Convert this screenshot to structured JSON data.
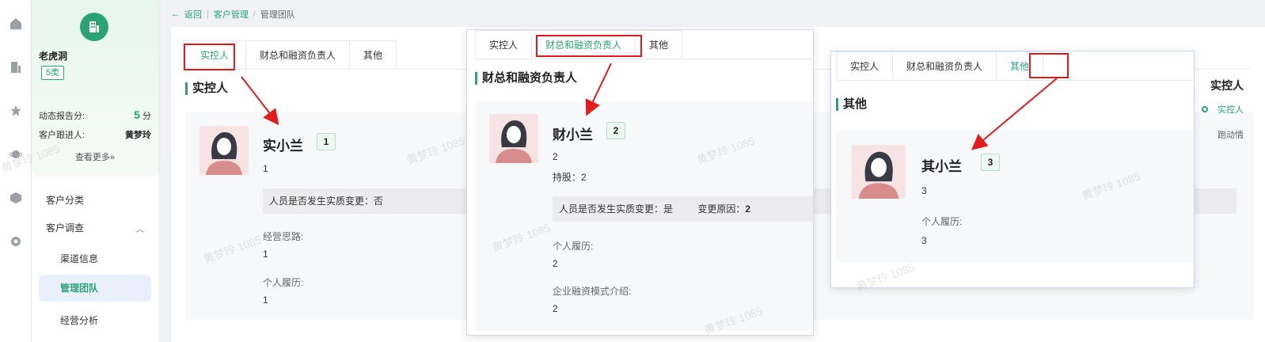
{
  "breadcrumb": {
    "back": "返回",
    "parent": "客户管理",
    "sep": "/",
    "current": "管理团队"
  },
  "rail": {
    "icons": [
      "home-icon",
      "building-icon",
      "star-icon",
      "planet-icon",
      "cube-icon",
      "settings-icon"
    ]
  },
  "sidebar": {
    "company_name": "老虎洞",
    "category_tag": "5类",
    "score_label": "动态报告分:",
    "score_value": "5",
    "score_unit": "分",
    "follower_label": "客户跟进人:",
    "follower_value": "黄梦玲",
    "view_more": "查看更多»",
    "menu": {
      "classification": "客户分类",
      "survey": "客户调查",
      "channel": "渠道信息",
      "team": "管理团队",
      "operation": "经营分析"
    }
  },
  "panel1": {
    "tabs": [
      "实控人",
      "财总和融资负责人",
      "其他"
    ],
    "active_tab": "实控人",
    "section_title": "实控人",
    "person": {
      "name": "实小兰",
      "badge": "1",
      "subtitle": "1",
      "change_question": "人员是否发生实质变更：否",
      "strategy_label": "经营思路:",
      "strategy_value": "1",
      "resume_label": "个人履历:",
      "resume_value": "1"
    }
  },
  "panel2": {
    "tabs": [
      "实控人",
      "财总和融资负责人",
      "其他"
    ],
    "active_tab": "财总和融资负责人",
    "section_title": "财总和融资负责人",
    "person": {
      "name": "财小兰",
      "badge": "2",
      "subtitle": "2",
      "shares": "持股：2",
      "change_question": "人员是否发生实质变更：是",
      "change_reason_label": "变更原因：",
      "change_reason_value": "2",
      "resume_label": "个人履历:",
      "resume_value": "2",
      "financing_label": "企业融资模式介绍:",
      "financing_value": "2"
    }
  },
  "panel3": {
    "tabs": [
      "实控人",
      "财总和融资负责人",
      "其他"
    ],
    "active_tab": "其他",
    "section_title": "其他",
    "person": {
      "name": "其小兰",
      "badge": "3",
      "subtitle": "3",
      "resume_label": "个人履历:",
      "resume_value": "3"
    }
  },
  "right_partial": {
    "title": "实控人",
    "item1": "实控人",
    "item2": "跑动情"
  },
  "watermark": "黄梦玲 1085",
  "colors": {
    "accent": "#2aa375",
    "annotation_red": "#e21c1c",
    "avatar_bg": "#f6e3e3"
  }
}
